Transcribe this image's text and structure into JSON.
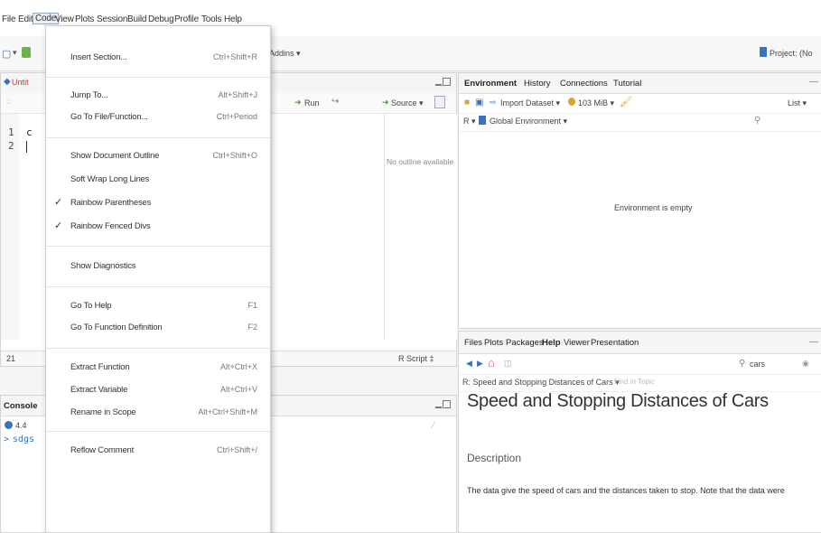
{
  "menubar": {
    "items": [
      "File",
      "Edit",
      "Code",
      "View",
      "Plots",
      "Session",
      "Build",
      "Debug",
      "Profile",
      "Tools",
      "Help"
    ],
    "active": "Code"
  },
  "toolbar": {
    "addins_label": "Addins ▾",
    "project_label": "Project: (No"
  },
  "code_menu": {
    "items": [
      {
        "label": "Insert Section...",
        "shortcut": "Ctrl+Shift+R"
      },
      {
        "label": "Jump To...",
        "shortcut": "Alt+Shift+J"
      },
      {
        "label": "Go To File/Function...",
        "shortcut": "Ctrl+Period"
      },
      {
        "label": "Show Document Outline",
        "shortcut": "Ctrl+Shift+O"
      },
      {
        "label": "Soft Wrap Long Lines",
        "shortcut": ""
      },
      {
        "label": "Rainbow Parentheses",
        "shortcut": "",
        "checked": true
      },
      {
        "label": "Rainbow Fenced Divs",
        "shortcut": "",
        "checked": true
      },
      {
        "label": "Show Diagnostics",
        "shortcut": ""
      },
      {
        "label": "Go To Help",
        "shortcut": "F1"
      },
      {
        "label": "Go To Function Definition",
        "shortcut": "F2"
      },
      {
        "label": "Extract Function",
        "shortcut": "Alt+Ctrl+X"
      },
      {
        "label": "Extract Variable",
        "shortcut": "Alt+Ctrl+V"
      },
      {
        "label": "Rename in Scope",
        "shortcut": "Alt+Ctrl+Shift+M"
      },
      {
        "label": "Reflow Comment",
        "shortcut": "Ctrl+Shift+/"
      }
    ],
    "check_glyph": "✓"
  },
  "editor": {
    "tab_fragment": "Untit",
    "line_numbers": [
      "1",
      "2"
    ],
    "line1_fragment": "c",
    "run_label": "Run",
    "source_label": "Source ▾",
    "outline_text": "No outline available",
    "status_line": "21",
    "status_type": "R Script ‡"
  },
  "console": {
    "title": "Console",
    "version_fragment": "4.4",
    "prompt": ">",
    "prompt_text": "sdgs"
  },
  "env_pane": {
    "tabs": [
      "Environment",
      "History",
      "Connections",
      "Tutorial"
    ],
    "import_label": "Import Dataset ▾",
    "memory_label": "103 MiB ▾",
    "list_label": "List ▾",
    "r_label": "R ▾",
    "global_env_label": "Global Environment ▾",
    "empty_text": "Environment is empty"
  },
  "files_pane": {
    "tabs": [
      "Files",
      "Plots",
      "Packages",
      "Help",
      "Viewer",
      "Presentation"
    ],
    "search_value": "cars",
    "breadcrumb": "R: Speed and Stopping Distances of Cars ▾",
    "find_placeholder": "Find in Topic",
    "help_title": "Speed and Stopping Distances of Cars",
    "section_heading": "Description",
    "body_text": "The data give the speed of cars and the distances taken to stop. Note that the data were"
  },
  "colors": {
    "accent_blue": "#3b73b9",
    "home_icon": "#e0662f",
    "check_green": "#4b9a3a"
  }
}
